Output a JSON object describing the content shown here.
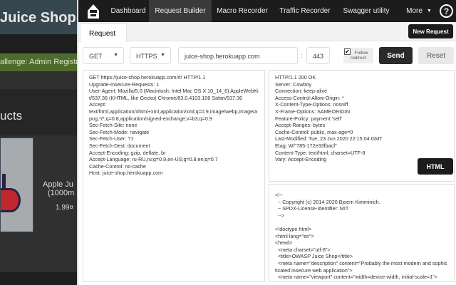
{
  "background": {
    "title": "Juice Shop",
    "banner": "allenge: Admin Registration",
    "section": "ucts",
    "product_name_1": "Apple Ju",
    "product_name_2": "(1000m",
    "product_price": "1.99¤"
  },
  "nav": {
    "items": [
      "Dashboard",
      "Request Builder",
      "Macro Recorder",
      "Traffic Recorder",
      "Swagger utility"
    ],
    "more": "More",
    "help": "?"
  },
  "tabs": {
    "request": "Request",
    "new_request": "New Request"
  },
  "form": {
    "method": "GET",
    "protocol": "HTTPS",
    "host": "juice-shop.herokuapp.com",
    "separator": ":",
    "port": "443",
    "follow_label_1": "Follow",
    "follow_label_2": "redirect",
    "follow_checked": true,
    "send": "Send",
    "reset": "Reset"
  },
  "request_text": "GET https://juice-shop.herokuapp.com/#/ HTTP/1.1\nUpgrade-Insecure-Requests: 1\nUser-Agent: Mozilla/5.0 (Macintosh; Intel Mac OS X 10_14_6) AppleWebKit/537.36 (KHTML, like Gecko) Chrome/83.0.4103.106 Safari/537.36\nAccept:\ntext/html,application/xhtml+xml,application/xml;q=0.9,image/webp,image/apng,*/*;q=0.8,application/signed-exchange;v=b3;q=0.9\nSec-Fetch-Site: none\nSec-Fetch-Mode: navigate\nSec-Fetch-User: ?1\nSec-Fetch-Dest: document\nAccept-Encoding: gzip, deflate, br\nAccept-Language: ru-RU,ru;q=0.9,en-US;q=0.8,en;q=0.7\nCache-Control: no-cache\nHost: juice-shop.herokuapp.com",
  "response_headers": "HTTP/1.1 200 OK\nServer: Cowboy\nConnection: keep-alive\nAccess-Control-Allow-Origin: *\nX-Content-Type-Options: nosniff\nX-Frame-Options: SAMEORIGIN\nFeature-Policy: payment 'self'\nAccept-Ranges: bytes\nCache-Control: public, max-age=0\nLast-Modified: Tue, 23 Jun 2020 22:15:04 GMT\nEtag: W/\"785-172e33fbacf\"\nContent-Type: text/html; charset=UTF-8\nVary: Accept-Encoding",
  "response_body": "<!--\n  ~ Copyright (c) 2014-2020 Bjoern Kimminich.\n  ~ SPDX-License-Identifier: MIT\n  -->\n\n<!doctype html>\n<html lang=\"en\">\n<head>\n  <meta charset=\"utf-8\">\n  <title>OWASP Juice Shop</title>\n  <meta name=\"description\" content=\"Probably the most modern and sophisticated insecure web application\">\n  <meta name=\"viewport\" content=\"width=device-width, initial-scale=1\">\n  <link id=\"favicon\" rel=\"icon\" type=\"image/x-icon\" href=\"assets/public/favicon_js.ico\">\n  <link rel=\"stylesheet\" type=\"text/css\" href=\"//cdnjs.cloudflare.com/ajax/libs/cookieconsent2/3.1.0/cookieconsent.min.css\">",
  "view_mode": "HTML"
}
